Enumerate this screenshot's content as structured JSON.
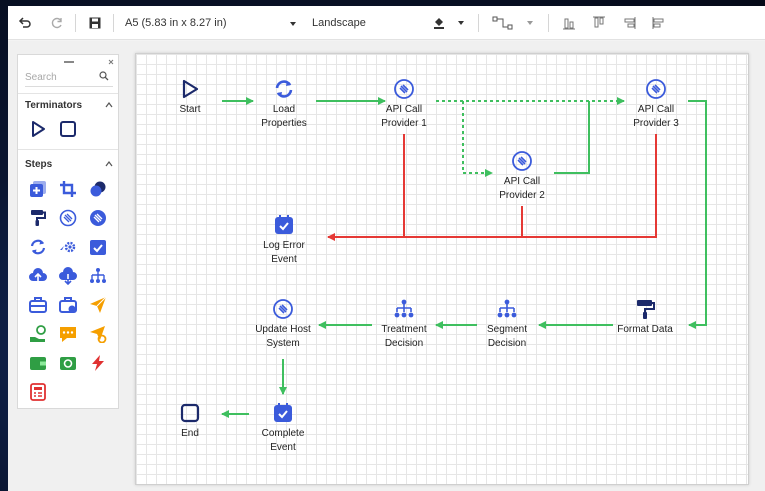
{
  "toolbar": {
    "undo_icon": "undo-icon",
    "redo_icon": "redo-icon",
    "save_icon": "save-icon",
    "page_size": "A5 (5.83 in x 8.27 in)",
    "orientation": "Landscape",
    "fill_icon": "fill-bucket-icon",
    "connector_icon": "connector-style-icon",
    "align_icons": [
      "align-bottom-icon",
      "align-top-icon",
      "align-right-icon",
      "align-left-icon"
    ]
  },
  "palette": {
    "search_placeholder": "Search",
    "sections": [
      {
        "title": "Terminators",
        "icons": [
          "play-terminator-icon",
          "square-terminator-icon"
        ]
      },
      {
        "title": "Steps",
        "icons": [
          "add-square-icon",
          "crop-icon",
          "coins-icon",
          "paint-roller-icon",
          "api-circle-icon",
          "api-circle-filled-icon",
          "refresh-icon",
          "gear-flow-icon",
          "checklist-icon",
          "cloud-upload-icon",
          "cloud-download-icon",
          "decision-tree-icon",
          "toolbox-icon",
          "toolbox-gear-icon",
          "send-icon",
          "hand-coin-icon",
          "message-icon",
          "send-gear-icon",
          "wallet-icon",
          "cash-icon",
          "bolt-icon",
          "calculator-icon"
        ]
      }
    ],
    "colors": {
      "blue": "#3b5bdb",
      "green": "#2f9e44",
      "orange": "#f59f00",
      "red": "#e03131",
      "navy": "#1c2a6b"
    }
  },
  "diagram": {
    "nodes": [
      {
        "id": "start",
        "label": [
          "Start"
        ],
        "icon": "play-icon"
      },
      {
        "id": "load",
        "label": [
          "Load",
          "Properties"
        ],
        "icon": "refresh-icon"
      },
      {
        "id": "api1",
        "label": [
          "API Call",
          "Provider 1"
        ],
        "icon": "api-icon"
      },
      {
        "id": "api2",
        "label": [
          "API Call",
          "Provider 2"
        ],
        "icon": "api-icon"
      },
      {
        "id": "api3",
        "label": [
          "API Call",
          "Provider 3"
        ],
        "icon": "api-icon"
      },
      {
        "id": "logerr",
        "label": [
          "Log Error",
          "Event"
        ],
        "icon": "checklist-icon"
      },
      {
        "id": "format",
        "label": [
          "Format Data"
        ],
        "icon": "paint-roller-icon"
      },
      {
        "id": "segment",
        "label": [
          "Segment",
          "Decision"
        ],
        "icon": "decision-tree-icon"
      },
      {
        "id": "treatment",
        "label": [
          "Treatment",
          "Decision"
        ],
        "icon": "decision-tree-icon"
      },
      {
        "id": "update",
        "label": [
          "Update Host",
          "System"
        ],
        "icon": "api-icon"
      },
      {
        "id": "complete",
        "label": [
          "Complete",
          "Event"
        ],
        "icon": "checklist-icon"
      },
      {
        "id": "end",
        "label": [
          "End"
        ],
        "icon": "stop-icon"
      }
    ],
    "edges": [
      {
        "from": "start",
        "to": "load",
        "style": "success"
      },
      {
        "from": "load",
        "to": "api1",
        "style": "success"
      },
      {
        "from": "api1",
        "to": "api3",
        "style": "fallback"
      },
      {
        "from": "api1",
        "to": "api2",
        "style": "fallback"
      },
      {
        "from": "api2",
        "to": "api3",
        "style": "success"
      },
      {
        "from": "api1",
        "to": "logerr",
        "style": "error"
      },
      {
        "from": "api2",
        "to": "logerr",
        "style": "error"
      },
      {
        "from": "api3",
        "to": "logerr",
        "style": "error"
      },
      {
        "from": "api3",
        "to": "format",
        "style": "success"
      },
      {
        "from": "format",
        "to": "segment",
        "style": "success"
      },
      {
        "from": "segment",
        "to": "treatment",
        "style": "success"
      },
      {
        "from": "treatment",
        "to": "update",
        "style": "success"
      },
      {
        "from": "update",
        "to": "complete",
        "style": "success"
      },
      {
        "from": "complete",
        "to": "end",
        "style": "success"
      }
    ],
    "colors": {
      "success": "#3fbf5f",
      "error": "#e53935",
      "icon": "#3b5bdb",
      "navy": "#1c2a6b"
    }
  }
}
